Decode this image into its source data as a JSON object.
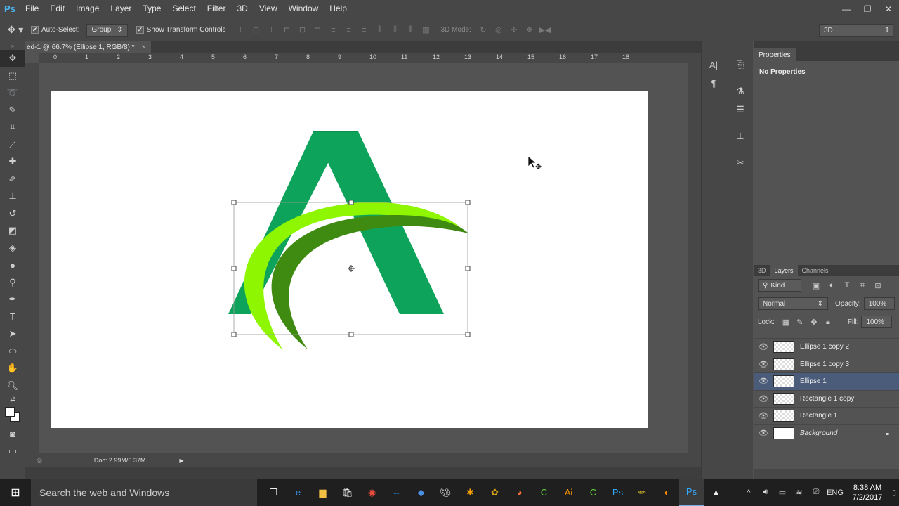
{
  "app": {
    "logo": "Ps",
    "menu": [
      "File",
      "Edit",
      "Image",
      "Layer",
      "Type",
      "Select",
      "Filter",
      "3D",
      "View",
      "Window",
      "Help"
    ]
  },
  "window_controls": [
    "—",
    "❐",
    "✕"
  ],
  "options_bar": {
    "auto_select_label": "Auto-Select:",
    "auto_select_checked": "✔",
    "auto_select_target": "Group",
    "show_transform_label": "Show Transform Controls",
    "show_transform_checked": "✔",
    "mode_label": "3D Mode:",
    "workspace": "3D"
  },
  "document": {
    "tab_title": "ed-1 @ 66.7% (Ellipse 1, RGB/8) *",
    "tab_close": "×",
    "ruler_ticks": [
      "0",
      "1",
      "2",
      "3",
      "4",
      "5",
      "6",
      "7",
      "8",
      "9",
      "10",
      "11",
      "12",
      "13",
      "14",
      "15",
      "16",
      "17",
      "18"
    ],
    "status_doc": "Doc: 2.99M/6.37M",
    "status_arrow": "▶"
  },
  "artwork": {
    "letter_color": "#0ea35a",
    "swoosh_light": "#8ef600",
    "swoosh_dark": "#3f8b12"
  },
  "properties": {
    "title": "Properties",
    "empty_text": "No Properties"
  },
  "layers_panel": {
    "tabs": [
      "3D",
      "Layers",
      "Channels"
    ],
    "active_tab": "Layers",
    "filter_kind": "Kind",
    "blend_mode": "Normal",
    "opacity_label": "Opacity:",
    "opacity_value": "100%",
    "lock_label": "Lock:",
    "fill_label": "Fill:",
    "fill_value": "100%",
    "layers": [
      {
        "name": "Ellipse 1 copy 2",
        "selected": false
      },
      {
        "name": "Ellipse 1 copy 3",
        "selected": false
      },
      {
        "name": "Ellipse 1",
        "selected": true
      },
      {
        "name": "Rectangle 1 copy",
        "selected": false
      },
      {
        "name": "Rectangle 1",
        "selected": false
      },
      {
        "name": "Background",
        "selected": false
      }
    ]
  },
  "taskbar": {
    "search_placeholder": "Search the web and Windows",
    "language": "ENG",
    "time": "8:38 AM",
    "date": "7/2/2017"
  }
}
